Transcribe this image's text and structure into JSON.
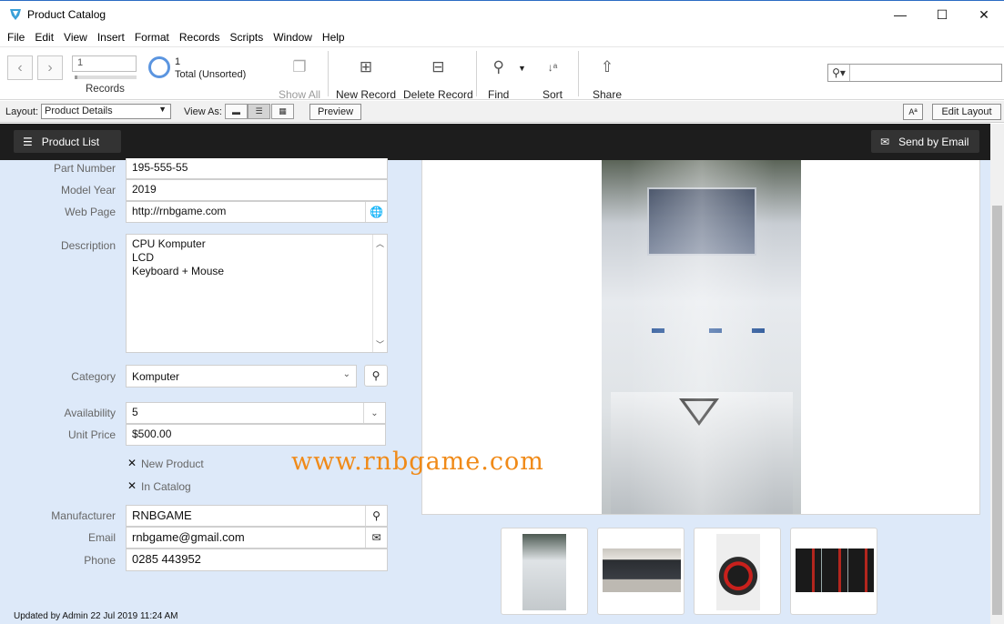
{
  "window": {
    "title": "Product Catalog",
    "controls": {
      "minimize": "—",
      "maximize": "☐",
      "close": "✕"
    }
  },
  "menu": [
    "File",
    "Edit",
    "View",
    "Insert",
    "Format",
    "Records",
    "Scripts",
    "Window",
    "Help"
  ],
  "toolbar": {
    "record_input": "1",
    "records_label": "Records",
    "found_count": "1",
    "total_label": "Total (Unsorted)",
    "show_all": "Show All",
    "new_record": "New Record",
    "delete_record": "Delete Record",
    "find": "Find",
    "sort": "Sort",
    "share": "Share",
    "search_value": ""
  },
  "layoutbar": {
    "layout_label": "Layout:",
    "layout_value": "Product Details",
    "view_as_label": "View As:",
    "preview": "Preview",
    "font_size_btn": "Aª",
    "edit_layout": "Edit Layout"
  },
  "header": {
    "product_list": "Product List",
    "send_by_email": "Send by Email"
  },
  "fields": {
    "part_number": {
      "label": "Part Number",
      "value": "195-555-55"
    },
    "model_year": {
      "label": "Model Year",
      "value": "2019"
    },
    "web_page": {
      "label": "Web Page",
      "value": "http://rnbgame.com"
    },
    "description": {
      "label": "Description",
      "lines": [
        "CPU Komputer",
        "LCD",
        "Keyboard + Mouse"
      ]
    },
    "category": {
      "label": "Category",
      "value": "Komputer"
    },
    "availability": {
      "label": "Availability",
      "value": "5"
    },
    "unit_price": {
      "label": "Unit Price",
      "value": "$500.00"
    },
    "new_product": {
      "label": "New Product",
      "checked": "✕"
    },
    "in_catalog": {
      "label": "In Catalog",
      "checked": "✕"
    },
    "manufacturer": {
      "label": "Manufacturer",
      "value": "RNBGAME"
    },
    "email": {
      "label": "Email",
      "value": "rnbgame@gmail.com"
    },
    "phone": {
      "label": "Phone",
      "value": "0285 443952"
    }
  },
  "watermark": "www.rnbgame.com",
  "footer": "Updated by Admin 22 Jul 2019 11:24 AM",
  "colors": {
    "accent": "#5b95e0",
    "content_bg": "#dde9f9",
    "header_bg": "#1d1d1d",
    "watermark": "#f08a18"
  }
}
